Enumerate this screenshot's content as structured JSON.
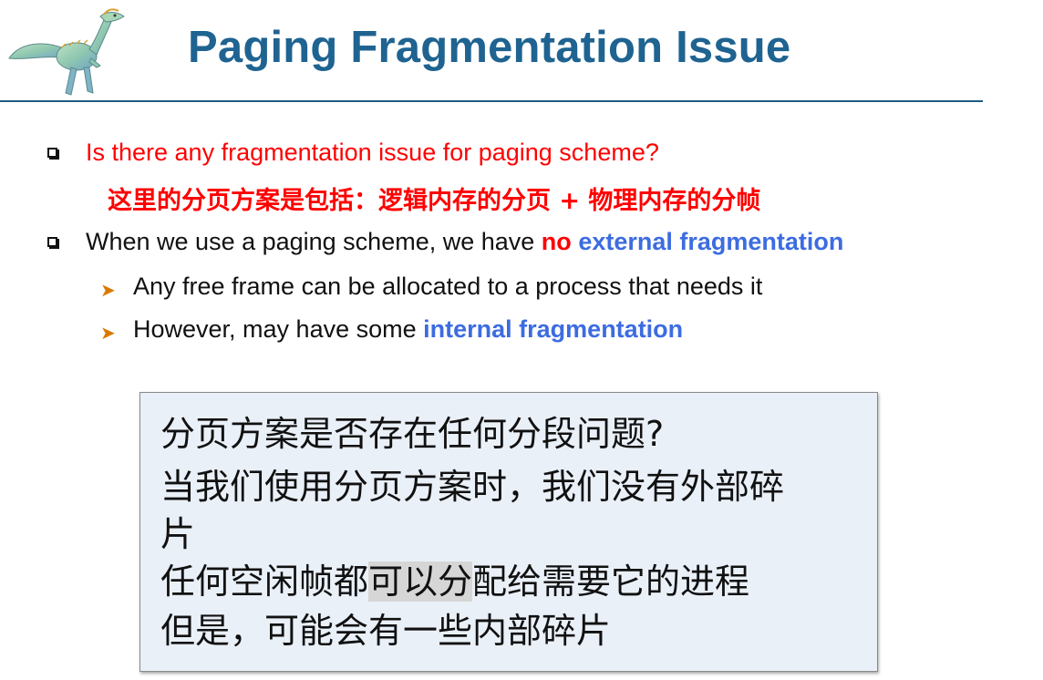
{
  "title": "Paging Fragmentation Issue",
  "bullets": {
    "q1": "Is there any fragmentation issue for paging scheme?",
    "q1_note": "这里的分页方案是包括：逻辑内存的分页 + 物理内存的分帧",
    "q2_prefix": "When we use a paging scheme, we have ",
    "q2_no": "no",
    "q2_ext": "external fragmentation",
    "sub1": "Any free frame can be allocated to a process that needs it",
    "sub2_prefix": "However, may have some ",
    "sub2_int": "internal fragmentation"
  },
  "popup": {
    "line1": "分页方案是否存在任何分段问题?",
    "line2": "当我们使用分页方案时，我们没有外部碎",
    "line3": "片",
    "line4_a": "任何空闲帧都",
    "line4_hl": "可以分",
    "line4_b": "配给需要它的进程",
    "line5": "但是，可能会有一些内部碎片"
  },
  "colors": {
    "title": "#1f6391",
    "red": "#ff0000",
    "blue": "#3c6ce0",
    "arrow": "#d97a00",
    "popup_bg": "#eaf0f8"
  },
  "icons": {
    "logo": "dinosaur-logo-icon",
    "bullet": "square-bullet-icon",
    "sub_bullet": "arrow-bullet-icon"
  }
}
